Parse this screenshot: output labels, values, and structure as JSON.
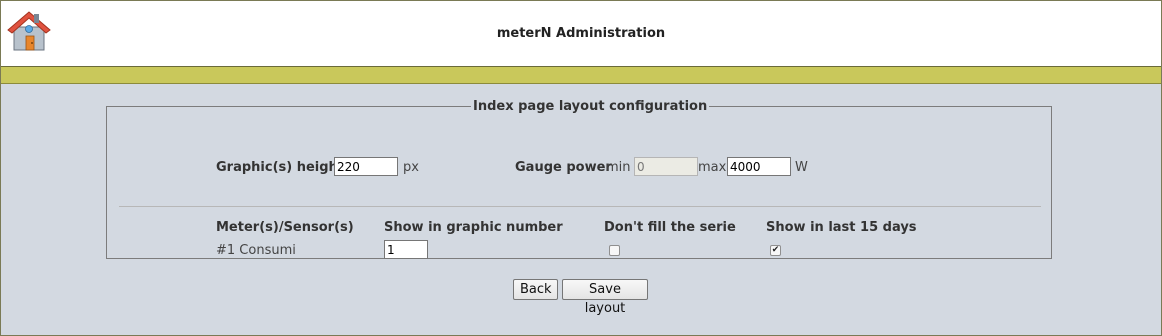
{
  "app": {
    "title": "meterN Administration",
    "logo_icon": "house-icon"
  },
  "colors": {
    "header_band": "#c9c85b",
    "page_background": "#d3d9e1"
  },
  "layout_config": {
    "legend": "Index page layout configuration",
    "graphic_height": {
      "label": "Graphic(s) height",
      "value": "220",
      "unit": "px"
    },
    "gauge_power": {
      "label": "Gauge power",
      "min_label": "min",
      "min_value": "0",
      "max_label": "max",
      "max_value": "4000",
      "unit": "W"
    },
    "meters_table": {
      "columns": [
        "Meter(s)/Sensor(s)",
        "Show in graphic number",
        "Don't fill the serie",
        "Show in last 15 days"
      ],
      "rows": [
        {
          "name": "#1 Consumi",
          "graphic_number": "1",
          "dont_fill": false,
          "show_last_15_days": true
        }
      ]
    }
  },
  "buttons": {
    "back": "Back",
    "save": "Save layout"
  }
}
